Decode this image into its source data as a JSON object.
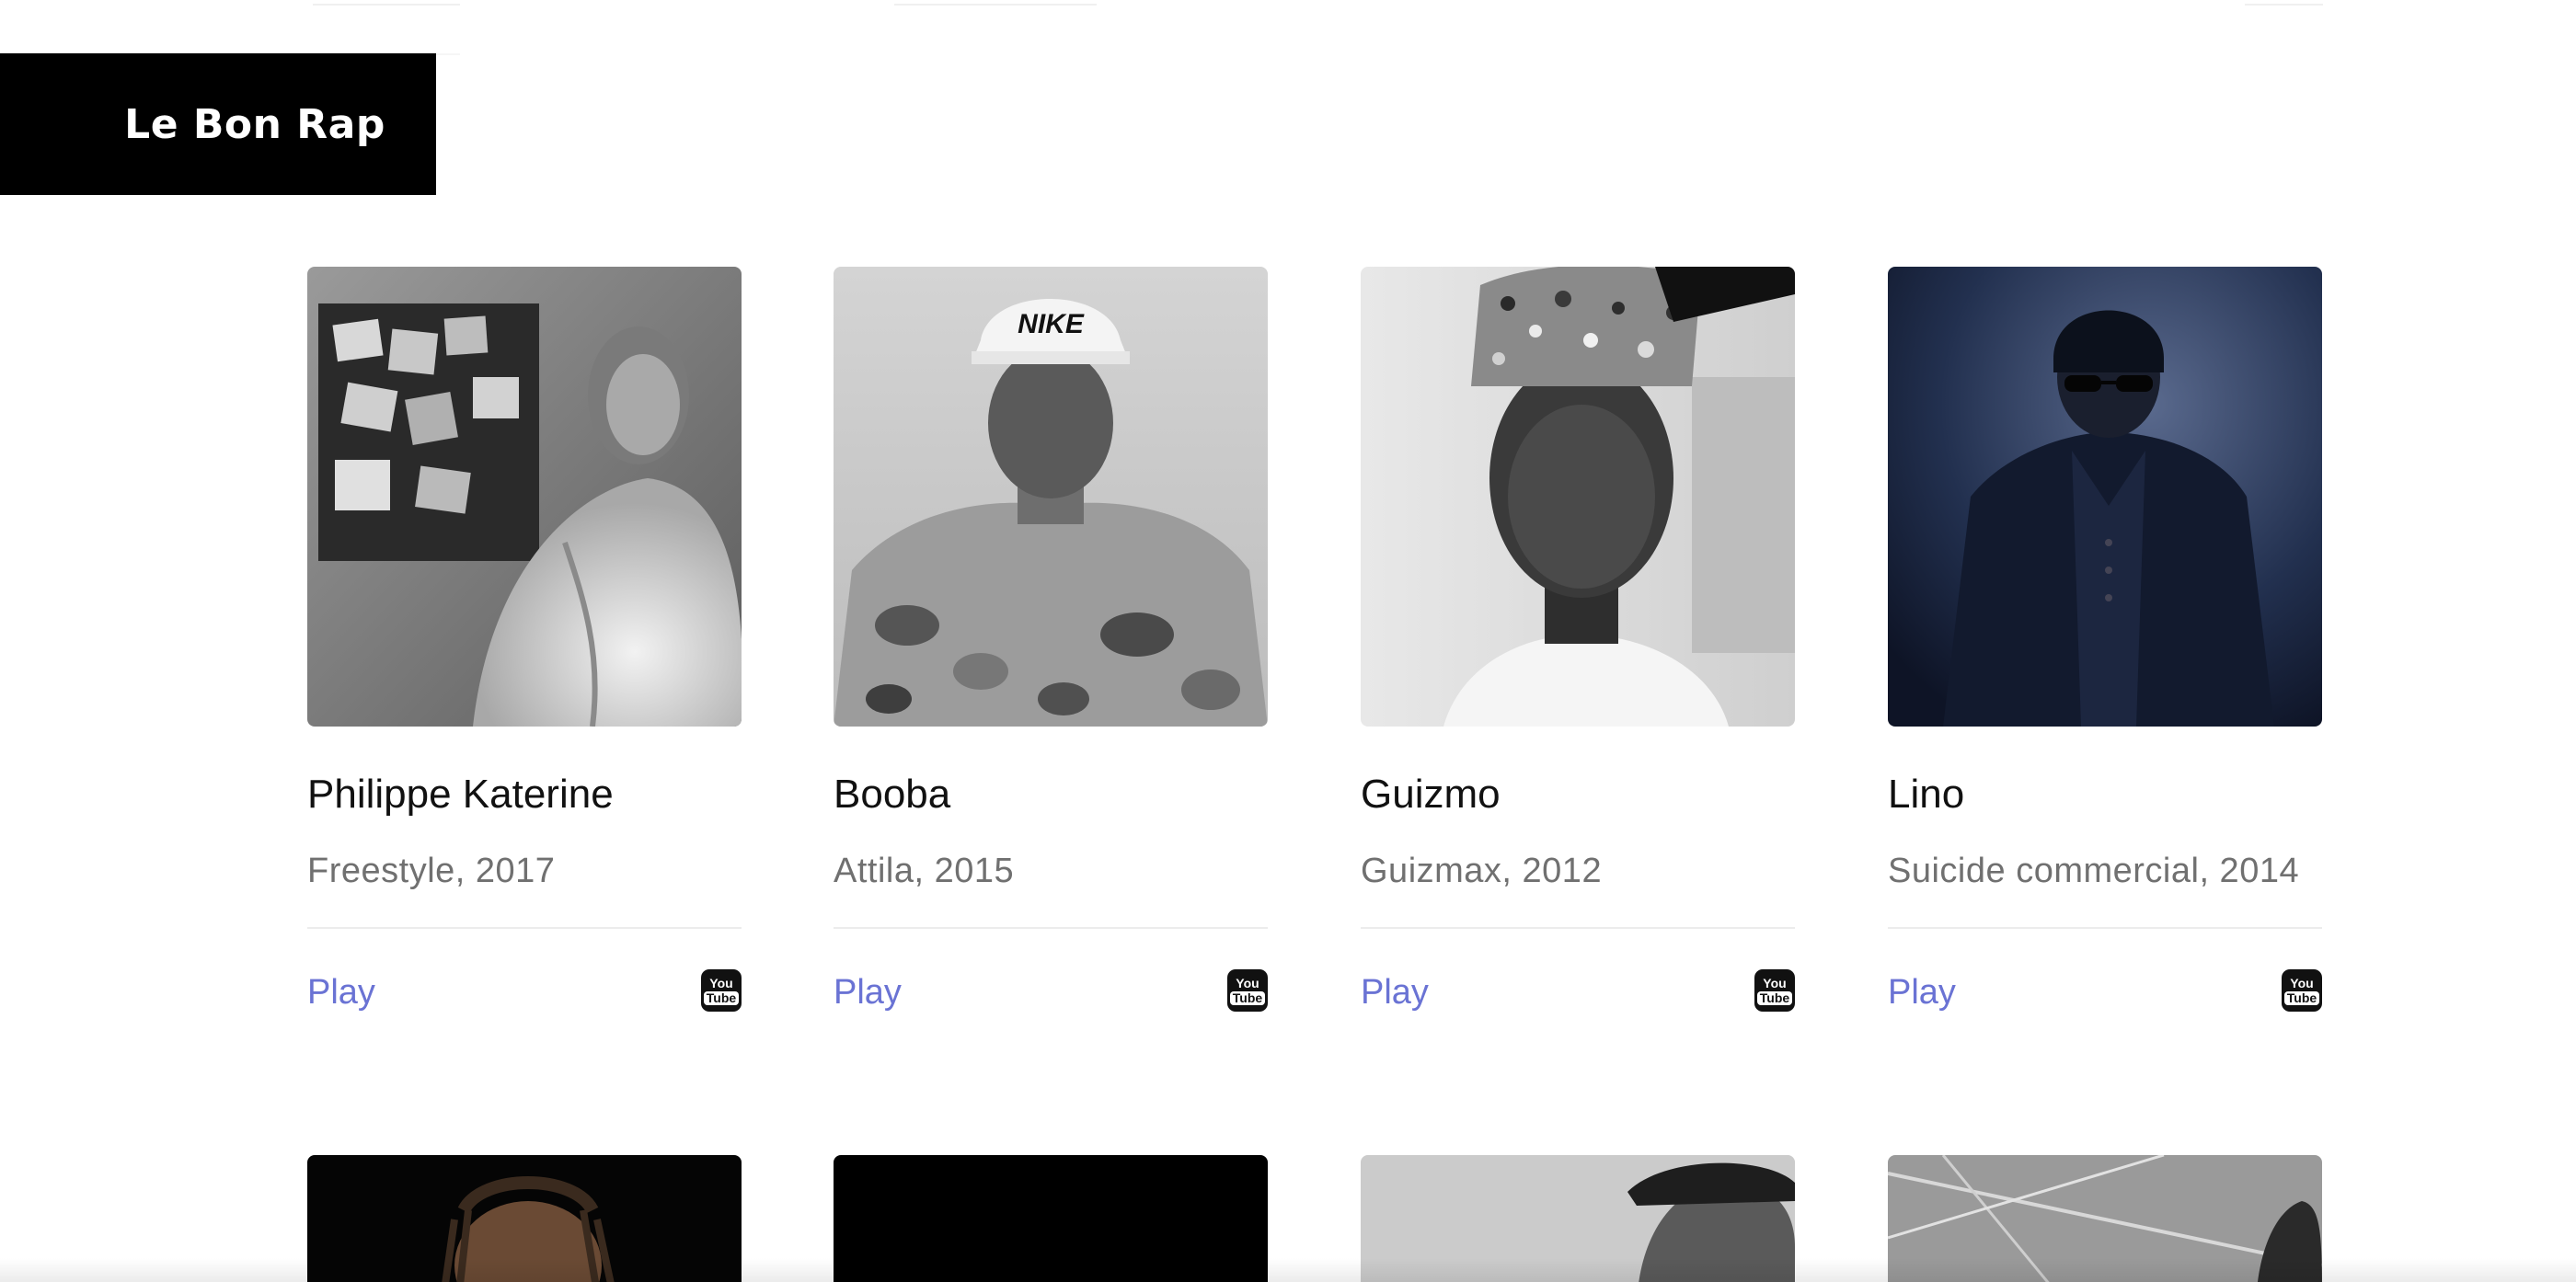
{
  "site": {
    "logo_text": "Le Bon Rap"
  },
  "cards": [
    {
      "artist": "Philippe Katerine",
      "track_info": "Freestyle, 2017",
      "play_label": "Play",
      "youtube_icon": "youtube-icon",
      "photo_tone": "#8a8a8a"
    },
    {
      "artist": "Booba",
      "track_info": "Attila, 2015",
      "play_label": "Play",
      "youtube_icon": "youtube-icon",
      "photo_tone": "#b5b5b5"
    },
    {
      "artist": "Guizmo",
      "track_info": "Guizmax, 2012",
      "play_label": "Play",
      "youtube_icon": "youtube-icon",
      "photo_tone": "#d8d8d8"
    },
    {
      "artist": "Lino",
      "track_info": "Suicide commercial, 2014",
      "play_label": "Play",
      "youtube_icon": "youtube-icon",
      "photo_tone": "#1e2a4a"
    }
  ],
  "youtube_badge": {
    "top": "You",
    "bottom": "Tube"
  },
  "colors": {
    "accent_link": "#6a73d4",
    "logo_bg": "#000000",
    "logo_text": "#ffffff",
    "meta_text": "#707070",
    "divider": "#ececec"
  }
}
